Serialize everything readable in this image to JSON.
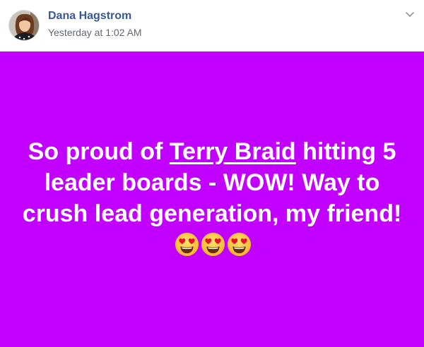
{
  "author": {
    "name": "Dana Hagstrom",
    "timestamp": "Yesterday at 1:02 AM"
  },
  "post": {
    "background_color": "#c100ff",
    "text_before": "So proud of ",
    "mention": "Terry Braid",
    "text_after": " hitting 5 leader boards - WOW! Way to crush lead generation, my friend!",
    "emojis": [
      "heart-eyes-emoji",
      "heart-eyes-emoji",
      "heart-eyes-emoji"
    ]
  },
  "colors": {
    "name_link": "#385898",
    "timestamp": "#616770",
    "post_text": "#ffffff"
  },
  "icons": {
    "options": "chevron-down-icon"
  }
}
